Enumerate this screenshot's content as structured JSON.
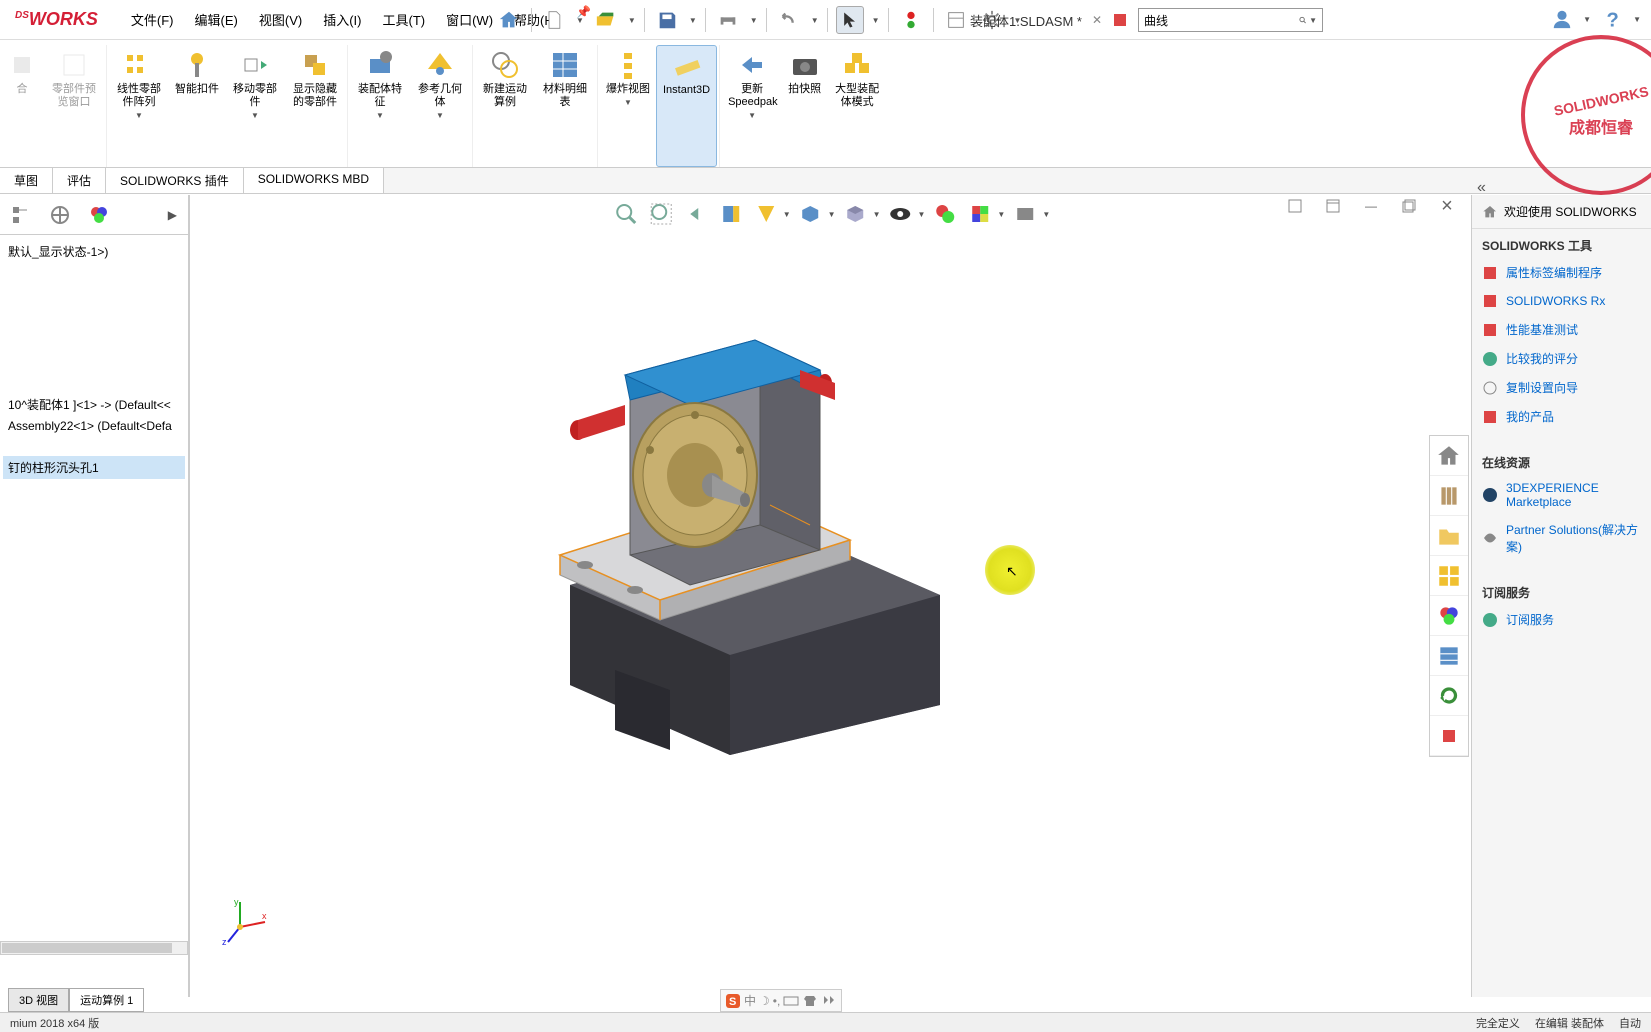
{
  "app": {
    "logo": "WORKS",
    "doc_name": "装配体1.SLDASM *",
    "search_placeholder": "曲线"
  },
  "menu": {
    "file": "文件(F)",
    "edit": "编辑(E)",
    "view": "视图(V)",
    "insert": "插入(I)",
    "tools": "工具(T)",
    "window": "窗口(W)",
    "help": "帮助(H)"
  },
  "ribbon": {
    "btn1": "合",
    "btn2": "零部件预览窗口",
    "btn3": "线性零部件阵列",
    "btn4": "智能扣件",
    "btn5": "移动零部件",
    "btn6": "显示隐藏的零部件",
    "btn7": "装配体特征",
    "btn8": "参考几何体",
    "btn9": "新建运动算例",
    "btn10": "材料明细表",
    "btn11": "爆炸视图",
    "btn12": "Instant3D",
    "btn13": "更新Speedpak",
    "btn14": "拍快照",
    "btn15": "大型装配体模式"
  },
  "tabs": {
    "sketch": "草图",
    "evaluate": "评估",
    "plugins": "SOLIDWORKS 插件",
    "mbd": "SOLIDWORKS MBD"
  },
  "tree": {
    "item1": "默认_显示状态-1>)",
    "item2": "10^装配体1 ]<1> -> (Default<<",
    "item3": "Assembly22<1> (Default<Defa",
    "item4": "钉的柱形沉头孔1"
  },
  "right_panel": {
    "welcome": "欢迎使用  SOLIDWORKS",
    "tools_title": "SOLIDWORKS 工具",
    "tool1": "属性标签编制程序",
    "tool2": "SOLIDWORKS Rx",
    "tool3": "性能基准测试",
    "tool4": "比较我的评分",
    "tool5": "复制设置向导",
    "tool6": "我的产品",
    "online_title": "在线资源",
    "online1": "3DEXPERIENCE Marketplace",
    "online2": "Partner Solutions(解决方案)",
    "subscribe_title": "订阅服务",
    "subscribe1": "订阅服务"
  },
  "bottom_tabs": {
    "view3d": "3D 视图",
    "motion": "运动算例 1"
  },
  "status": {
    "version": "mium 2018 x64 版",
    "define": "完全定义",
    "editing": "在编辑 装配体",
    "auto": "自动"
  },
  "stamp": {
    "line1": "SOLIDWORKS",
    "line2": "成都恒睿"
  },
  "ime": {
    "lang": "中"
  }
}
